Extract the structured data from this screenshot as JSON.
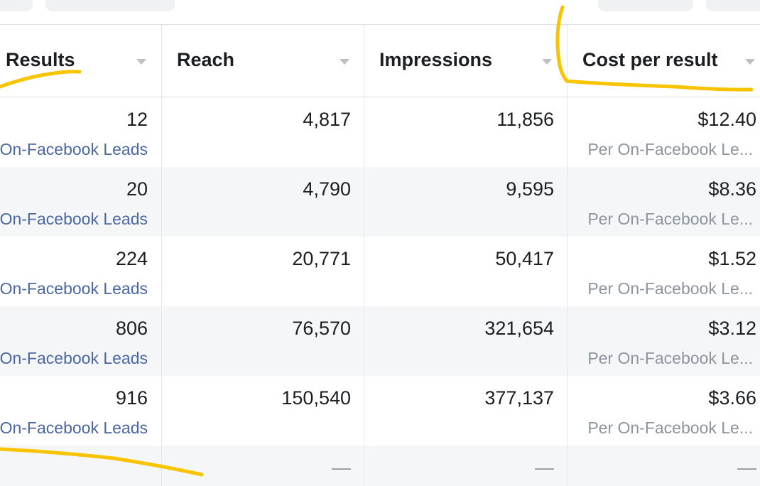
{
  "columns": {
    "results": "Results",
    "reach": "Reach",
    "impressions": "Impressions",
    "cost_per_result": "Cost per result"
  },
  "rows": [
    {
      "results": "12",
      "results_sub": "On-Facebook Leads",
      "reach": "4,817",
      "impressions": "11,856",
      "cost": "$12.40",
      "cost_sub": "Per On-Facebook Le..."
    },
    {
      "results": "20",
      "results_sub": "On-Facebook Leads",
      "reach": "4,790",
      "impressions": "9,595",
      "cost": "$8.36",
      "cost_sub": "Per On-Facebook Le..."
    },
    {
      "results": "224",
      "results_sub": "On-Facebook Leads",
      "reach": "20,771",
      "impressions": "50,417",
      "cost": "$1.52",
      "cost_sub": "Per On-Facebook Le..."
    },
    {
      "results": "806",
      "results_sub": "On-Facebook Leads",
      "reach": "76,570",
      "impressions": "321,654",
      "cost": "$3.12",
      "cost_sub": "Per On-Facebook Le..."
    },
    {
      "results": "916",
      "results_sub": "On-Facebook Leads",
      "reach": "150,540",
      "impressions": "377,137",
      "cost": "$3.66",
      "cost_sub": "Per On-Facebook Le..."
    }
  ],
  "totals": {
    "reach": "—",
    "impressions": "—",
    "cost": "—"
  },
  "colors": {
    "highlight": "#f8c400",
    "link": "#4b67a1",
    "muted": "#8d949e",
    "text": "#1c1e21"
  },
  "icons": {
    "sort": "sort-caret-down-icon"
  }
}
